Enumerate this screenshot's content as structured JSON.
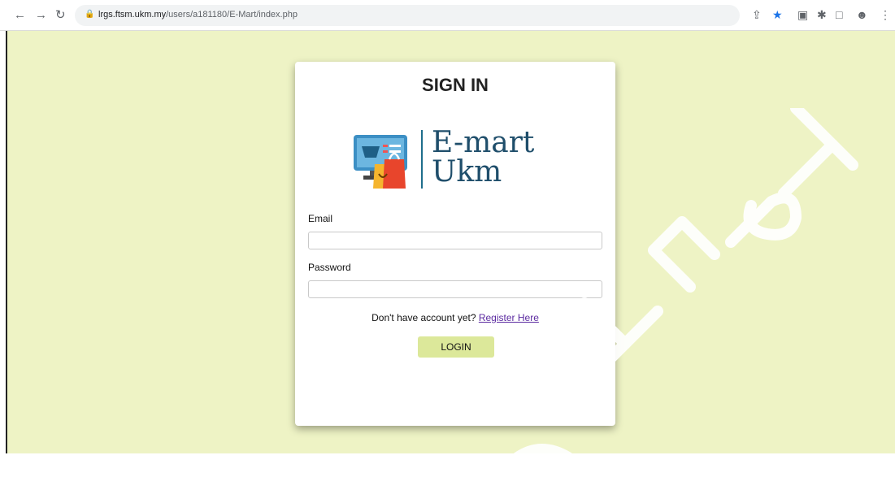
{
  "browser": {
    "url_host": "lrgs.ftsm.ukm.my",
    "url_path": "/users/a181180/E-Mart/index.php",
    "icons": [
      "back-icon",
      "forward-icon",
      "reload-icon",
      "lock-icon",
      "share-icon",
      "star-icon",
      "extension-icon",
      "puzzle-icon",
      "sidepanel-icon",
      "profile-icon",
      "menu-icon"
    ]
  },
  "form": {
    "title": "SIGN IN",
    "logo_line1": "E-mart",
    "logo_line2": "Ukm",
    "email_label": "Email",
    "password_label": "Password",
    "email_value": "",
    "password_value": "",
    "register_prompt": "Don't have account yet?",
    "register_link": "Register Here",
    "login_label": "LOGIN"
  },
  "colors": {
    "page_bg": "#eef3c5",
    "button_bg": "#dce89a",
    "logo_text": "#1f4e6b"
  },
  "watermark": "@FTSM"
}
